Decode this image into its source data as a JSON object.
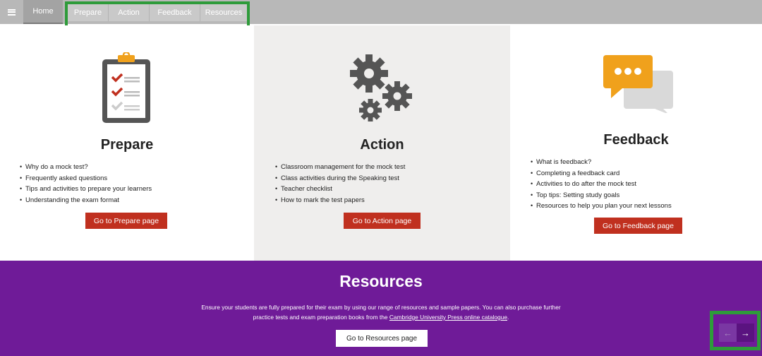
{
  "nav": {
    "home": "Home",
    "items": [
      "Prepare",
      "Action",
      "Feedback",
      "Resources"
    ]
  },
  "cards": {
    "prepare": {
      "title": "Prepare",
      "bullets": [
        "Why do a mock test?",
        "Frequently asked questions",
        "Tips and activities to prepare your learners",
        "Understanding the exam format"
      ],
      "button": "Go to Prepare page"
    },
    "action": {
      "title": "Action",
      "bullets": [
        "Classroom management for the mock test",
        "Class activities during the Speaking test",
        "Teacher checklist",
        "How to mark the test papers"
      ],
      "button": "Go to Action page"
    },
    "feedback": {
      "title": "Feedback",
      "bullets": [
        "What is feedback?",
        "Completing a feedback card",
        "Activities to do after the mock test",
        "Top tips: Setting study goals",
        "Resources to help you plan your next lessons"
      ],
      "button": "Go to Feedback page"
    }
  },
  "resources": {
    "title": "Resources",
    "text_line1": "Ensure your students are fully prepared for their exam by using our range of resources and sample papers. You can also purchase further",
    "text_line2_prefix": "practice tests and exam preparation books from the",
    "link": "Cambridge University Press online catalogue",
    "text_line2_suffix": ".",
    "button": "Go to Resources page"
  },
  "pager": {
    "prev": "←",
    "next": "→"
  },
  "colors": {
    "accent_red": "#c0301f",
    "purple": "#6f1b98",
    "highlight_green": "#2e9b3a",
    "nav_gray": "#b8b8b8",
    "icon_orange": "#f0a11c"
  },
  "icons": [
    "menu-icon",
    "clipboard-checklist-icon",
    "gears-icon",
    "speech-bubbles-icon",
    "arrow-left-icon",
    "arrow-right-icon"
  ]
}
